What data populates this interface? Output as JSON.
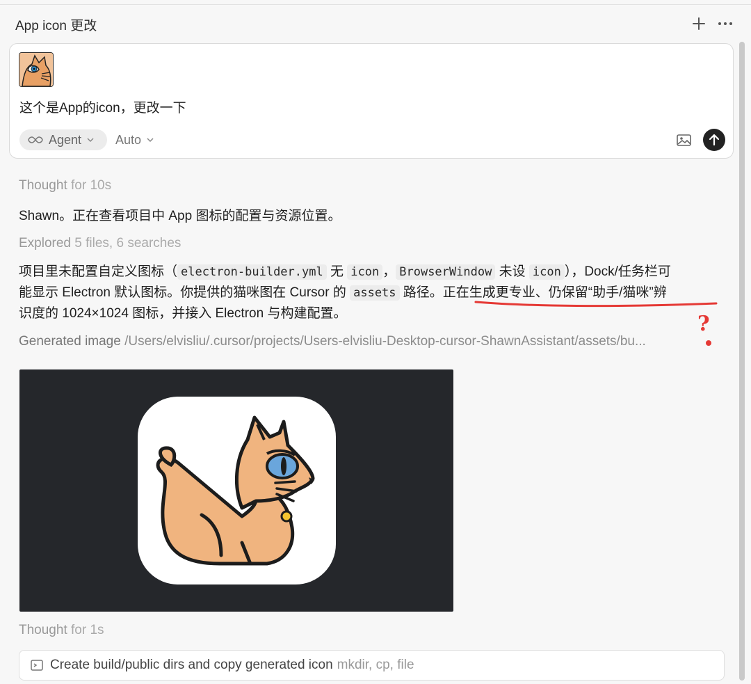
{
  "header": {
    "title": "App icon 更改",
    "plus_icon": "plus-icon",
    "more_icon": "more-icon"
  },
  "composer": {
    "attachment_icon": "cat-thumbnail",
    "message": "这个是App的icon，更改一下",
    "mode_label": "Agent",
    "model_label": "Auto",
    "image_icon": "image-icon",
    "send_icon": "arrow-up-icon"
  },
  "thread": {
    "thought1_label": "Thought",
    "thought1_duration": "for 10s",
    "status_line": "Shawn。正在查看项目中 App 图标的配置与资源位置。",
    "explored_label": "Explored",
    "explored_detail": "5 files, 6 searches",
    "para": {
      "l1_a": "项目里未配置自定义图标（",
      "code_builder": "electron-builder.yml",
      "l1_b": " 无 ",
      "code_icon1": "icon",
      "l1_c": "，",
      "code_window": "BrowserWindow",
      "l1_d": " 未设 ",
      "code_icon2": "icon",
      "l1_e": "），Dock/任务栏可",
      "l2_a": "能显示 Electron 默认图标。你提供的猫咪图在 Cursor 的 ",
      "code_assets": "assets",
      "l2_b": " 路径。正在生成更专业、仍保留“助手/猫咪”辨",
      "l3": "识度的 1024×1024 图标，并接入 Electron 与构建配置。"
    },
    "annotation_mark": "?",
    "generated_label": "Generated image",
    "generated_path": "/Users/elvisliu/.cursor/projects/Users-elvisliu-Desktop-cursor-ShawnAssistant/assets/bu...",
    "thought2_label": "Thought",
    "thought2_duration": "for 1s",
    "tool_command": "Create build/public dirs and copy generated icon",
    "tool_args": "mkdir, cp, file"
  },
  "colors": {
    "accent_annotation": "#e53935",
    "image_bg": "#25272b",
    "cat_fill": "#f0b47f"
  }
}
